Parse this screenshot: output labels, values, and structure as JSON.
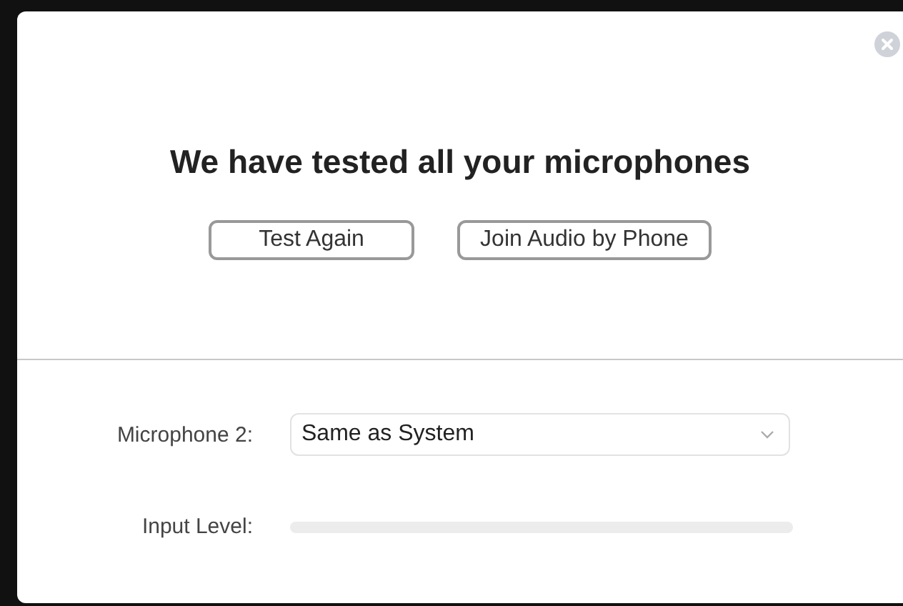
{
  "dialog": {
    "heading": "We have tested all your microphones",
    "buttons": [
      "Test Again",
      "Join Audio by Phone"
    ]
  },
  "microphone": {
    "label": "Microphone 2:",
    "value": "Same as System"
  },
  "input_level": {
    "label": "Input Level:",
    "level": 0
  }
}
